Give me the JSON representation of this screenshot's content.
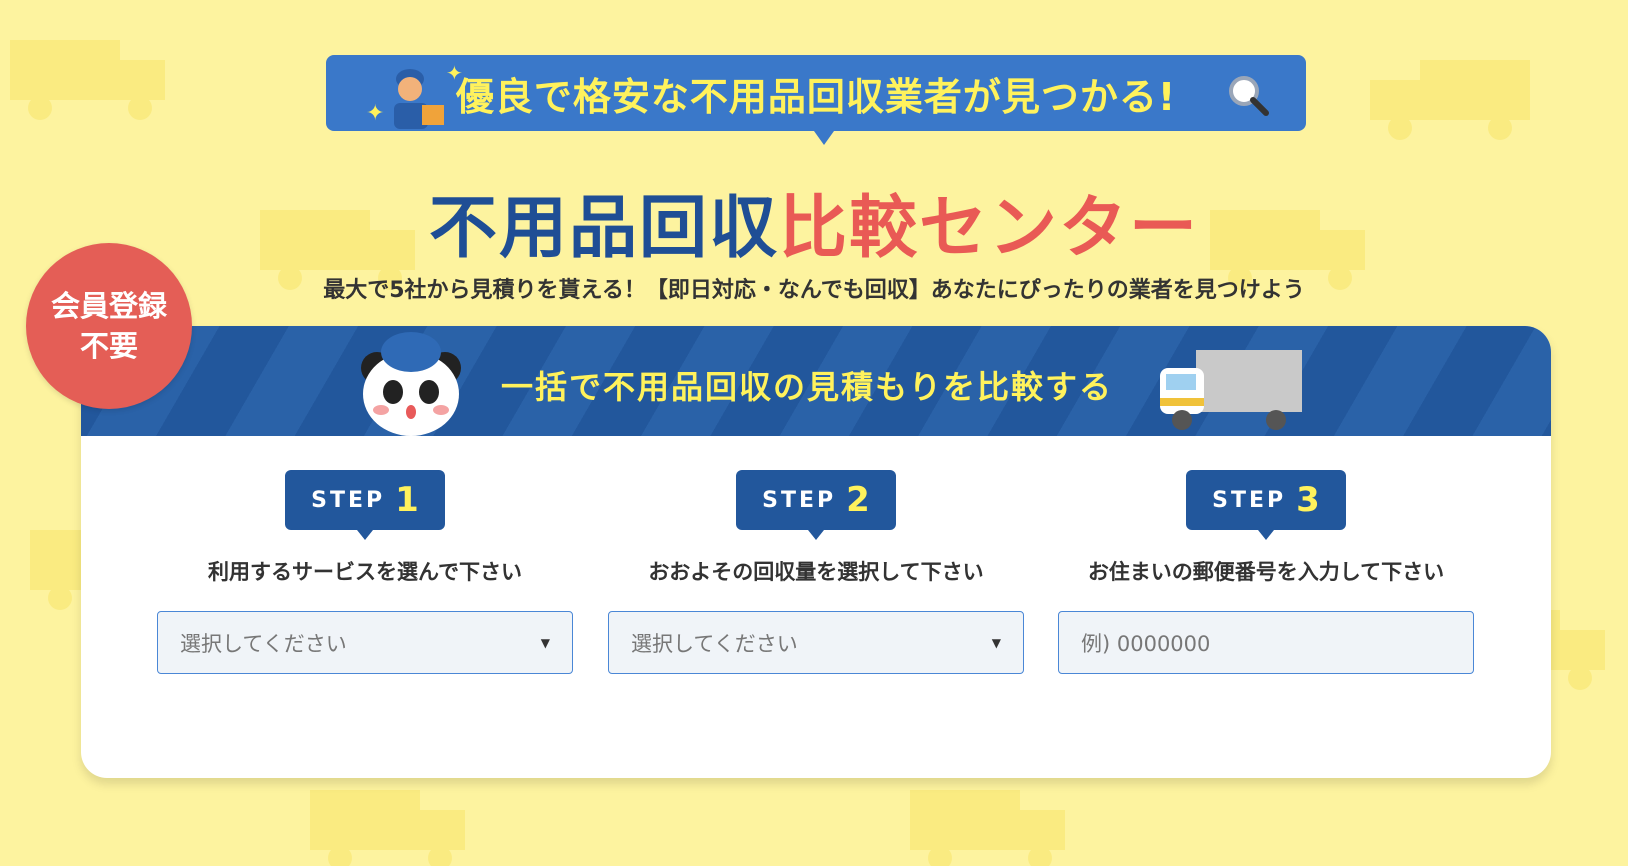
{
  "top_banner": {
    "text": "優良で格安な不用品回収業者が見つかる!",
    "icons": [
      "worker-icon",
      "sparkle-icon",
      "magnifier-icon"
    ]
  },
  "title": {
    "part1": "不用品回収",
    "part2": "比較センター"
  },
  "subtitle": "最大で5社から見積りを貰える！【即日対応・なんでも回収】あなたにぴったりの業者を見つけよう",
  "badge": {
    "line1": "会員登録",
    "line2": "不要"
  },
  "card": {
    "header_text": "一括で不用品回収の見積もりを比較する",
    "steps": [
      {
        "badge": "STEP",
        "num": "1",
        "label": "利用するサービスを選んで下さい",
        "field": "選択してください",
        "type": "select"
      },
      {
        "badge": "STEP",
        "num": "2",
        "label": "おおよその回収量を選択して下さい",
        "field": "選択してください",
        "type": "select"
      },
      {
        "badge": "STEP",
        "num": "3",
        "label": "お住まいの郵便番号を入力して下さい",
        "field": "例) 0000000",
        "type": "input"
      }
    ]
  },
  "colors": {
    "background": "#fdf39f",
    "blue": "#22579c",
    "banner_blue": "#3a78c9",
    "red": "#e45e56",
    "yellow_text": "#fff25c"
  }
}
